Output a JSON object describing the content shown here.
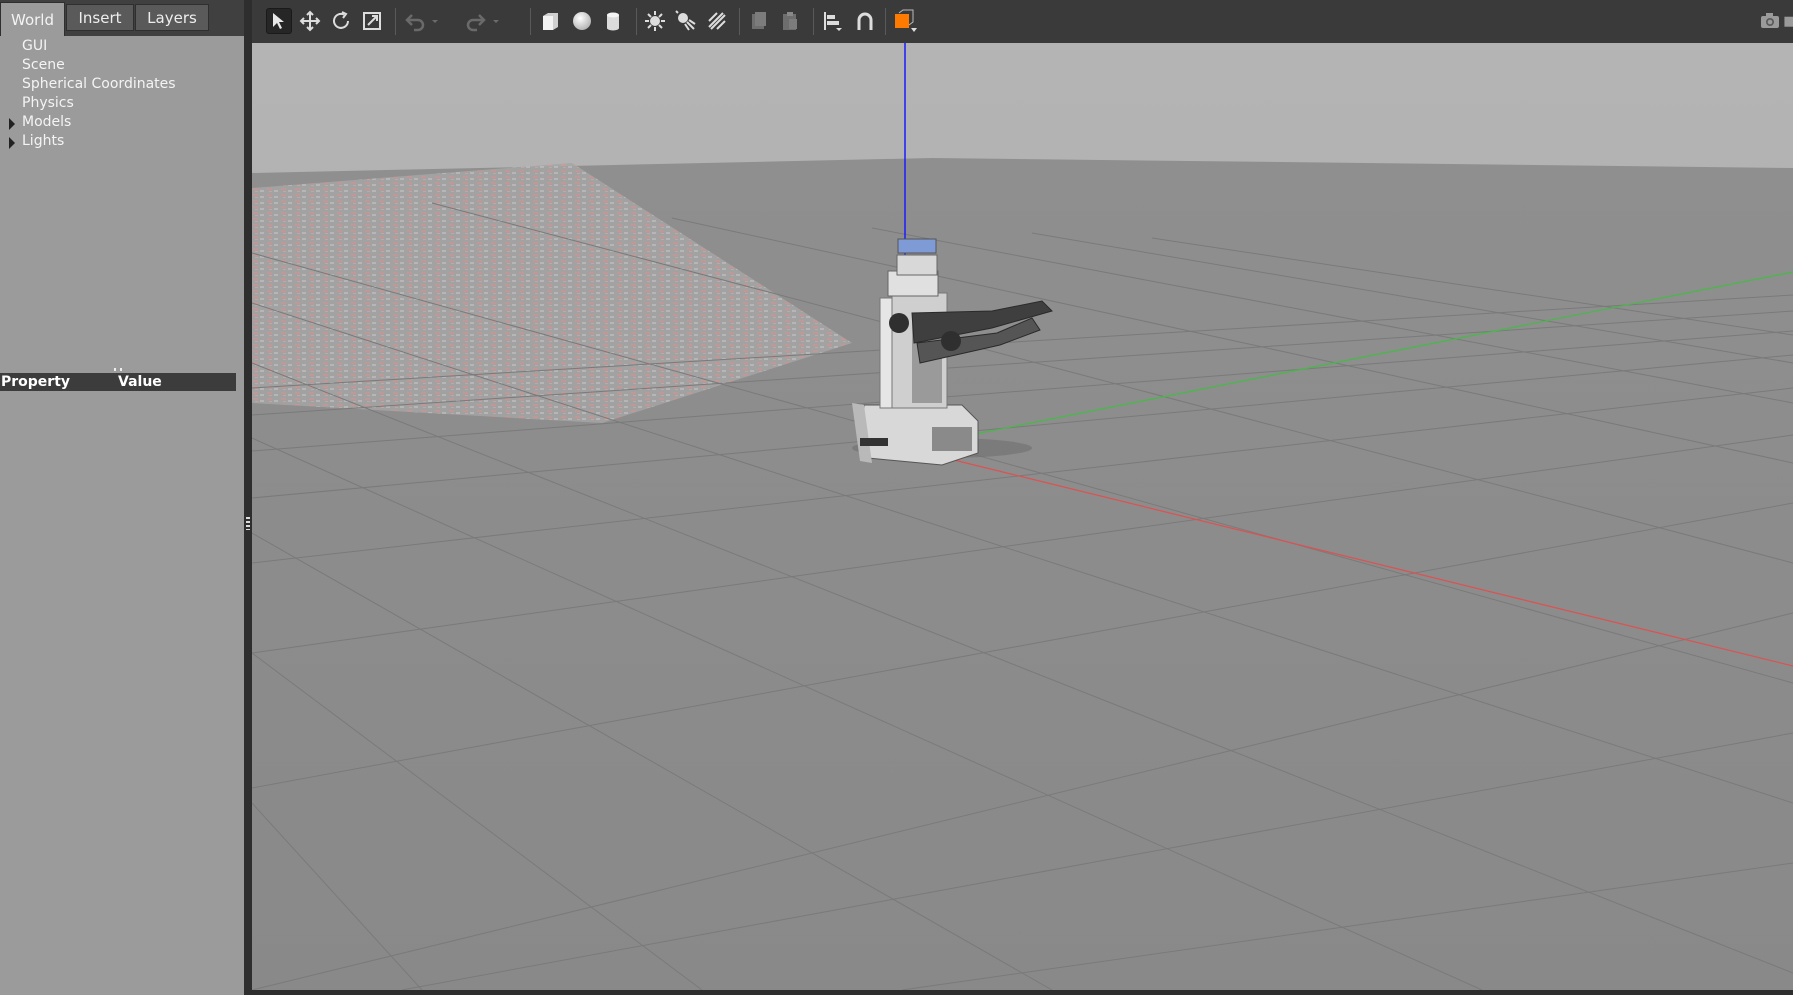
{
  "tabs": [
    {
      "label": "World",
      "active": true
    },
    {
      "label": "Insert",
      "active": false
    },
    {
      "label": "Layers",
      "active": false
    }
  ],
  "tree": {
    "items": [
      {
        "label": "GUI",
        "expandable": false
      },
      {
        "label": "Scene",
        "expandable": false
      },
      {
        "label": "Spherical Coordinates",
        "expandable": false
      },
      {
        "label": "Physics",
        "expandable": false
      },
      {
        "label": "Models",
        "expandable": true
      },
      {
        "label": "Lights",
        "expandable": true
      }
    ]
  },
  "properties": {
    "property_header": "Property",
    "value_header": "Value"
  },
  "toolbar": {
    "icons": [
      "select-arrow-icon",
      "translate-icon",
      "rotate-icon",
      "scale-icon",
      "undo-icon",
      "undo-history-icon",
      "redo-icon",
      "redo-history-icon",
      "box-shape-icon",
      "sphere-shape-icon",
      "cylinder-shape-icon",
      "point-light-icon",
      "spot-light-icon",
      "directional-light-icon",
      "copy-icon",
      "paste-icon",
      "align-icon",
      "snap-magnet-icon",
      "view-angle-icon",
      "screenshot-camera-icon"
    ]
  },
  "colors": {
    "panel": "#9b9b9b",
    "toolbar": "#3a3a3a",
    "sky": "#b0b0b0",
    "ground": "#8c8c8c",
    "axis_z": "#1a1aff",
    "axis_x": "#ff3333",
    "axis_y": "#33cc33",
    "view_angle_accent": "#ff7a00"
  }
}
